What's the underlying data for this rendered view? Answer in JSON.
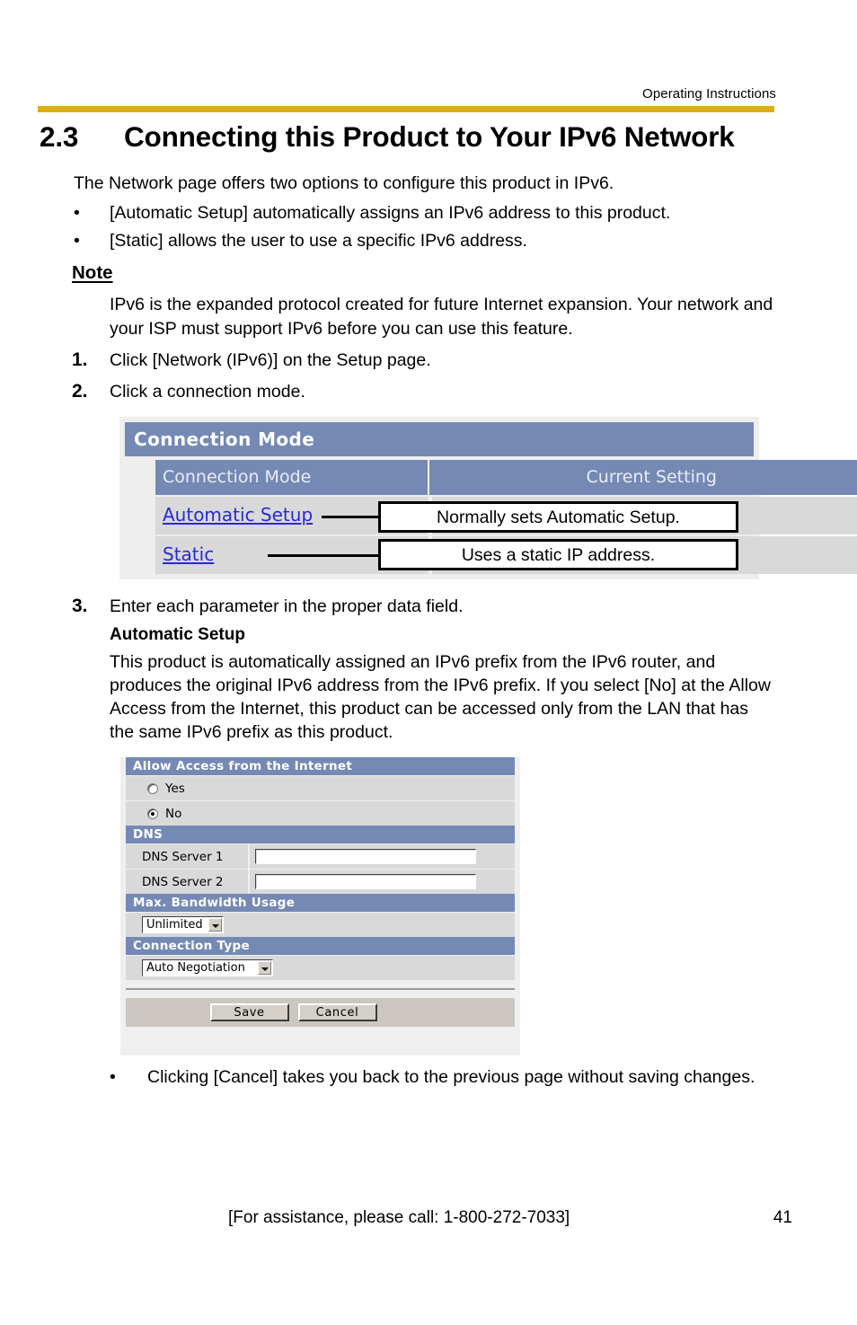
{
  "header": {
    "running_title": "Operating Instructions",
    "rule_color": "#dbb00c"
  },
  "section": {
    "number": "2.3",
    "title": "Connecting this Product to Your IPv6 Network"
  },
  "intro": "The Network page offers two options to configure this product in IPv6.",
  "intro_bullets": [
    "[Automatic Setup] automatically assigns an IPv6 address to this product.",
    "[Static] allows the user to use a specific IPv6 address."
  ],
  "bullet_glyph": "•",
  "note": {
    "heading": "Note",
    "body": "IPv6 is the expanded protocol created for future Internet expansion. Your network and your ISP must support IPv6 before you can use this feature."
  },
  "steps": [
    {
      "number": "1.",
      "text": "Click [Network (IPv6)] on the Setup page."
    },
    {
      "number": "2.",
      "text": "Click a connection mode."
    },
    {
      "number": "3.",
      "text": "Enter each parameter in the proper data field."
    }
  ],
  "subsection": {
    "heading": "Automatic Setup",
    "body": "This product is automatically assigned an IPv6 prefix from the IPv6 router, and produces the original IPv6 address from the IPv6 prefix. If you select [No] at the Allow Access from the Internet, this product can be accessed only from the LAN that has the same IPv6 prefix as this product."
  },
  "connection_mode_shot": {
    "title": "Connection Mode",
    "columns": [
      "Connection Mode",
      "Current Setting"
    ],
    "rows": [
      {
        "link": "Automatic Setup",
        "callout": "Normally sets Automatic Setup."
      },
      {
        "link": "Static",
        "callout": "Uses a static IP address."
      }
    ],
    "header_color": "#7589b5",
    "row_color": "#d9d9d9",
    "link_color": "#2828d8"
  },
  "settings_shot": {
    "sections": [
      {
        "bar": "Allow Access from the Internet",
        "radios": [
          {
            "label": "Yes",
            "selected": false
          },
          {
            "label": "No",
            "selected": true
          }
        ]
      },
      {
        "bar": "DNS",
        "fields": [
          {
            "label": "DNS Server 1",
            "value": ""
          },
          {
            "label": "DNS Server 2",
            "value": ""
          }
        ]
      },
      {
        "bar": "Max. Bandwidth Usage",
        "select": {
          "value": "Unlimited"
        }
      },
      {
        "bar": "Connection Type",
        "select": {
          "value": "Auto Negotiation"
        }
      }
    ],
    "buttons": [
      {
        "label": "Save"
      },
      {
        "label": "Cancel"
      }
    ],
    "header_color": "#7589b5",
    "row_color": "#d9d9d9"
  },
  "tail_bullet": "Clicking [Cancel] takes you back to the previous page without saving changes.",
  "footer": {
    "assistance": "[For assistance, please call: 1-800-272-7033]",
    "page_number": "41"
  }
}
